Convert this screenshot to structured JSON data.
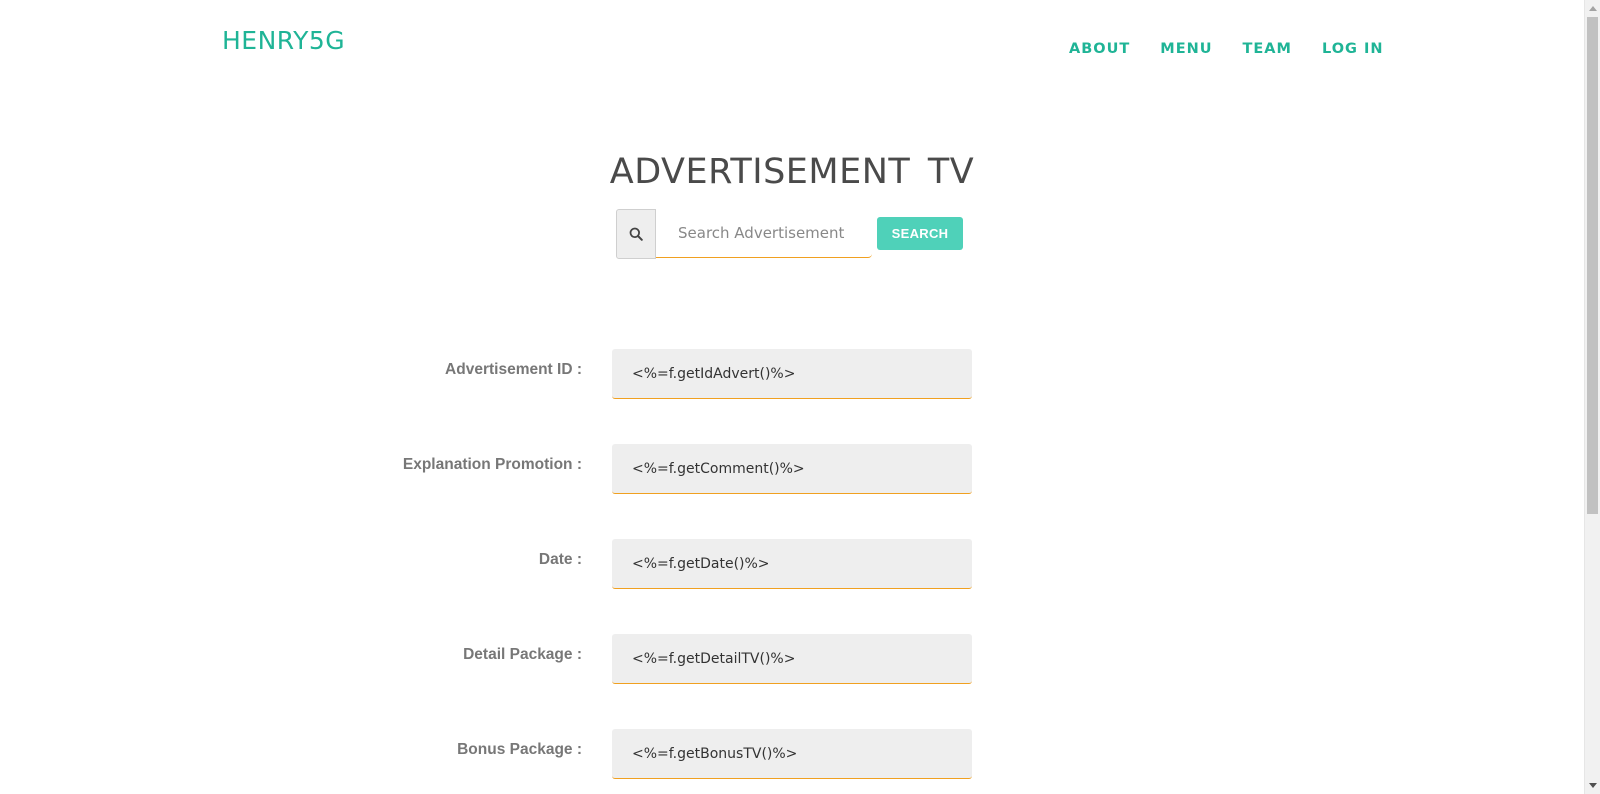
{
  "header": {
    "brand": "HENRY5G",
    "nav": [
      "ABOUT",
      "MENU",
      "TEAM",
      "LOG IN"
    ]
  },
  "main": {
    "title": "ADVERTISEMENT TV",
    "search": {
      "placeholder": "Search Advertisement",
      "button_label": "SEARCH",
      "icon": "search-icon"
    },
    "fields": [
      {
        "label": "Advertisement ID :",
        "value": "<%=f.getIdAdvert()%>"
      },
      {
        "label": "Explanation Promotion :",
        "value": "<%=f.getComment()%>"
      },
      {
        "label": "Date :",
        "value": "<%=f.getDate()%>"
      },
      {
        "label": "Detail Package :",
        "value": "<%=f.getDetailTV()%>"
      },
      {
        "label": "Bonus Package :",
        "value": "<%=f.getBonusTV()%>"
      }
    ]
  },
  "colors": {
    "brand": "#1fb496",
    "button": "#4fd1b9",
    "field_underline": "#f0a020",
    "field_bg": "#eeeeee"
  }
}
